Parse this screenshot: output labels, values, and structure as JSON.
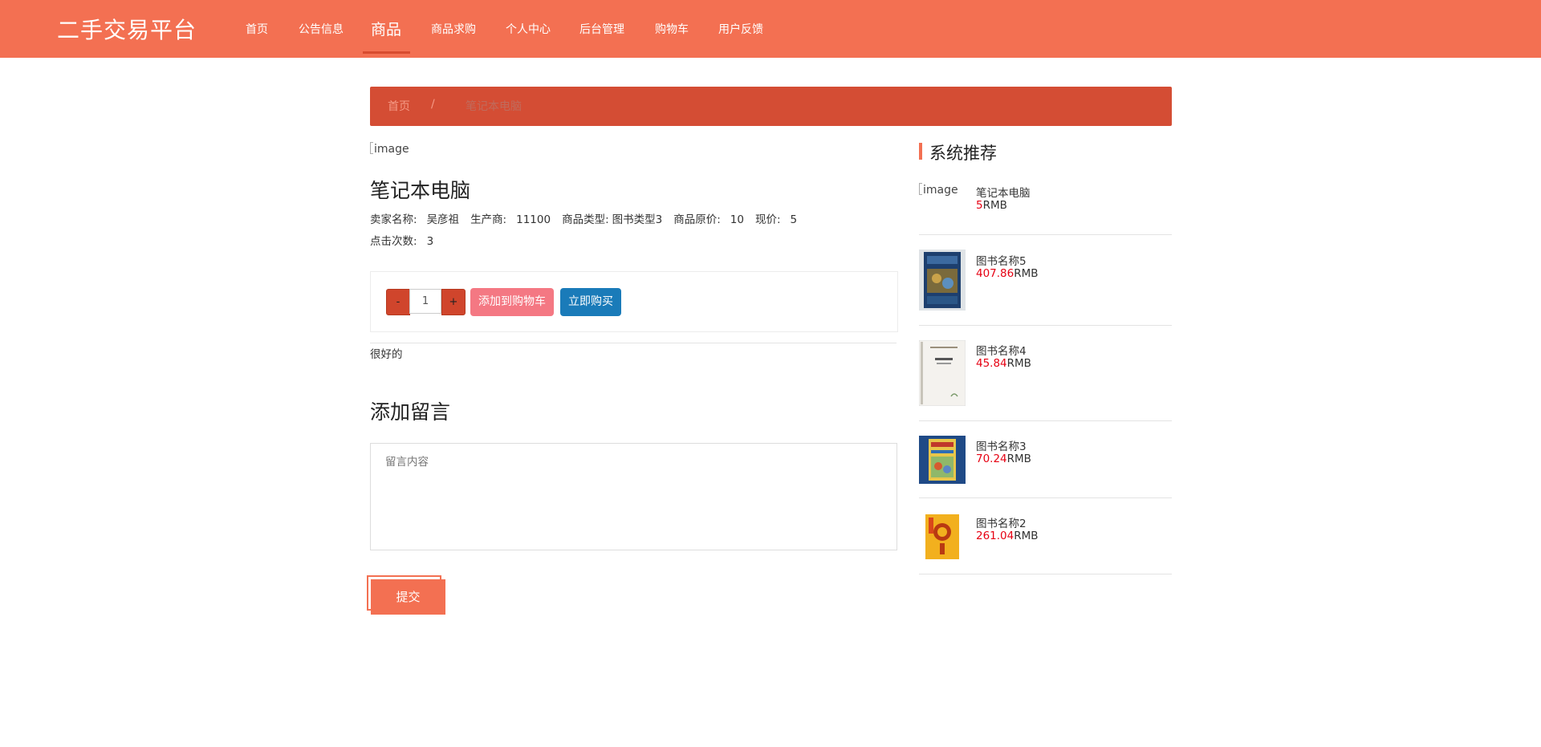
{
  "header": {
    "logo": "二手交易平台",
    "nav": [
      {
        "label": "首页"
      },
      {
        "label": "公告信息"
      },
      {
        "label": "商品"
      },
      {
        "label": "商品求购"
      },
      {
        "label": "个人中心"
      },
      {
        "label": "后台管理"
      },
      {
        "label": "购物车"
      },
      {
        "label": "用户反馈"
      }
    ],
    "active_nav": "商品"
  },
  "breadcrumb": {
    "home": "首页",
    "separator": "/",
    "current": "笔记本电脑"
  },
  "product": {
    "image_alt": "image",
    "title": "笔记本电脑",
    "seller_label": "卖家名称:",
    "seller": "吴彦祖",
    "maker_label": "生产商:",
    "maker": "11100",
    "type_label": "商品类型:",
    "type": "图书类型3",
    "orig_price_label": "商品原价:",
    "orig_price": "10",
    "price_label": "现价:",
    "price": "5",
    "clicks_label": "点击次数:",
    "clicks": "3",
    "description": "很好的"
  },
  "purchase": {
    "minus": "-",
    "plus": "+",
    "quantity": "1",
    "add_to_cart": "添加到购物车",
    "buy_now": "立即购买"
  },
  "message": {
    "heading": "添加留言",
    "placeholder": "留言内容",
    "submit": "提交"
  },
  "sidebar": {
    "title": "系统推荐",
    "currency": "RMB",
    "items": [
      {
        "name": "笔记本电脑",
        "price": "5",
        "image_alt": "image",
        "thumb": "none"
      },
      {
        "name": "图书名称5",
        "price": "407.86",
        "thumb": "book-blue"
      },
      {
        "name": "图书名称4",
        "price": "45.84",
        "thumb": "book-white"
      },
      {
        "name": "图书名称3",
        "price": "70.24",
        "thumb": "book-illustrated"
      },
      {
        "name": "图书名称2",
        "price": "261.04",
        "thumb": "book-yellow"
      }
    ]
  },
  "colors": {
    "header": "#f37052",
    "breadcrumb": "#d44d34",
    "cart_button": "#f47883",
    "buy_button": "#1a7bb9",
    "price_red": "#e60012"
  }
}
